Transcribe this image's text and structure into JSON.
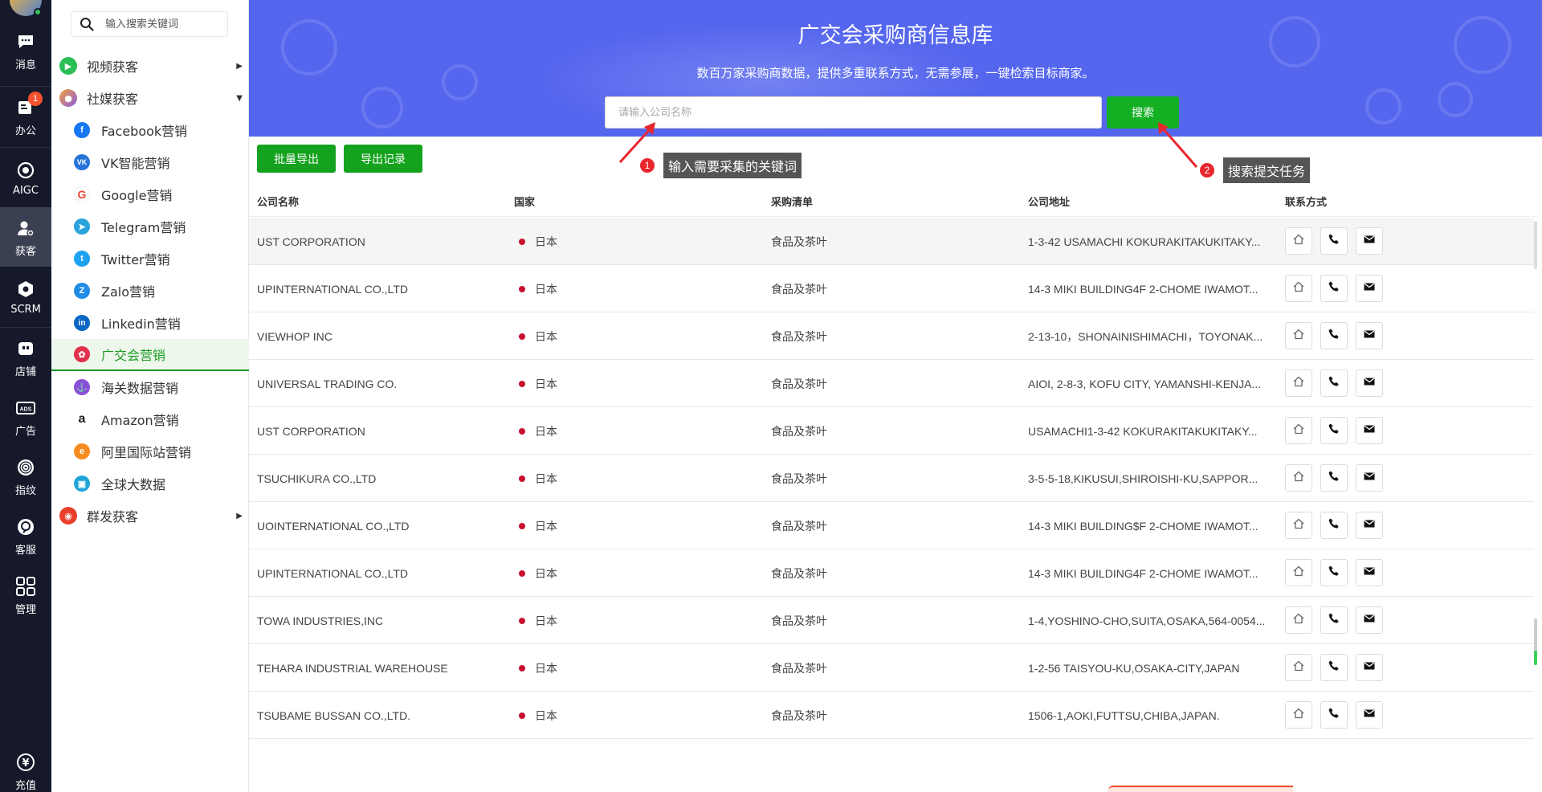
{
  "rail": {
    "items": [
      {
        "label": "消息",
        "icon": "chat-icon"
      },
      {
        "label": "办公",
        "icon": "office-icon",
        "badge": "1"
      },
      {
        "label": "AIGC",
        "icon": "aigc-icon"
      },
      {
        "label": "获客",
        "icon": "user-plus-icon"
      },
      {
        "label": "SCRM",
        "icon": "scrm-icon"
      },
      {
        "label": "店铺",
        "icon": "shop-icon"
      },
      {
        "label": "广告",
        "icon": "ads-icon"
      },
      {
        "label": "指纹",
        "icon": "fingerprint-icon"
      },
      {
        "label": "客服",
        "icon": "support-icon"
      },
      {
        "label": "管理",
        "icon": "grid-icon"
      },
      {
        "label": "充值",
        "icon": "yen-icon"
      }
    ]
  },
  "sidebar": {
    "search_placeholder": "输入搜索关键词",
    "top": [
      {
        "label": "视频获客",
        "color": "#2bbf55"
      },
      {
        "label": "社媒获客",
        "color": "#9b6be0"
      },
      {
        "label": "群发获客",
        "color": "#e8402a"
      }
    ],
    "items": [
      {
        "label": "Facebook营销",
        "color": "#1877f2",
        "glyph": "f"
      },
      {
        "label": "VK智能营销",
        "color": "#2774d8",
        "glyph": "VK"
      },
      {
        "label": "Google营销",
        "color": "#ea4335",
        "glyph": "G"
      },
      {
        "label": "Telegram营销",
        "color": "#2aa3dd",
        "glyph": "➤"
      },
      {
        "label": "Twitter营销",
        "color": "#1da1f2",
        "glyph": "t"
      },
      {
        "label": "Zalo营销",
        "color": "#1f8ce6",
        "glyph": "Z"
      },
      {
        "label": "Linkedin营销",
        "color": "#0a66c2",
        "glyph": "in"
      },
      {
        "label": "广交会营销",
        "color": "#e0324a",
        "glyph": "✿"
      },
      {
        "label": "海关数据营销",
        "color": "#8a4fd9",
        "glyph": "⚓"
      },
      {
        "label": "Amazon营销",
        "color": "#222222",
        "glyph": "a"
      },
      {
        "label": "阿里国际站营销",
        "color": "#f68b1f",
        "glyph": "e"
      },
      {
        "label": "全球大数据",
        "color": "#1fa3d8",
        "glyph": "▣"
      }
    ]
  },
  "banner": {
    "title": "广交会采购商信息库",
    "subtitle": "数百万家采购商数据，提供多重联系方式，无需参展，一键检索目标商家。",
    "input_placeholder": "请输入公司名称",
    "search_label": "搜索"
  },
  "toolbar": {
    "export_label": "批量导出",
    "records_label": "导出记录"
  },
  "tips": [
    {
      "num": "1",
      "text": "输入需要采集的关键词"
    },
    {
      "num": "2",
      "text": "搜索提交任务"
    }
  ],
  "table": {
    "columns": [
      "公司名称",
      "国家",
      "采购清单",
      "公司地址",
      "联系方式"
    ],
    "rows": [
      {
        "company": "UST CORPORATION",
        "country": "日本",
        "purchase": "食品及茶叶",
        "address": "1-3-42 USAMACHI KOKURAKITAKUKITAKY..."
      },
      {
        "company": "UPINTERNATIONAL CO.,LTD",
        "country": "日本",
        "purchase": "食品及茶叶",
        "address": "14-3 MIKI BUILDING4F 2-CHOME IWAMOT..."
      },
      {
        "company": "VIEWHOP INC",
        "country": "日本",
        "purchase": "食品及茶叶",
        "address": "2-13-10，SHONAINISHIMACHI，TOYONAK..."
      },
      {
        "company": "UNIVERSAL TRADING CO.",
        "country": "日本",
        "purchase": "食品及茶叶",
        "address": "AIOI, 2-8-3, KOFU CITY, YAMANSHI-KENJA..."
      },
      {
        "company": "UST CORPORATION",
        "country": "日本",
        "purchase": "食品及茶叶",
        "address": "USAMACHI1-3-42 KOKURAKITAKUKITAKY..."
      },
      {
        "company": "TSUCHIKURA CO.,LTD",
        "country": "日本",
        "purchase": "食品及茶叶",
        "address": "3-5-5-18,KIKUSUI,SHIROISHI-KU,SAPPOR..."
      },
      {
        "company": "UOINTERNATIONAL CO.,LTD",
        "country": "日本",
        "purchase": "食品及茶叶",
        "address": "14-3 MIKI BUILDING$F 2-CHOME IWAMOT..."
      },
      {
        "company": "UPINTERNATIONAL CO.,LTD",
        "country": "日本",
        "purchase": "食品及茶叶",
        "address": "14-3 MIKI BUILDING4F 2-CHOME IWAMOT..."
      },
      {
        "company": "TOWA INDUSTRIES,INC",
        "country": "日本",
        "purchase": "食品及茶叶",
        "address": "1-4,YOSHINO-CHO,SUITA,OSAKA,564-0054..."
      },
      {
        "company": "TEHARA INDUSTRIAL WAREHOUSE",
        "country": "日本",
        "purchase": "食品及茶叶",
        "address": "1-2-56 TAISYOU-KU,OSAKA-CITY,JAPAN"
      },
      {
        "company": "TSUBAME BUSSAN CO.,LTD.",
        "country": "日本",
        "purchase": "食品及茶叶",
        "address": "1506-1,AOKI,FUTTSU,CHIBA,JAPAN."
      }
    ]
  }
}
